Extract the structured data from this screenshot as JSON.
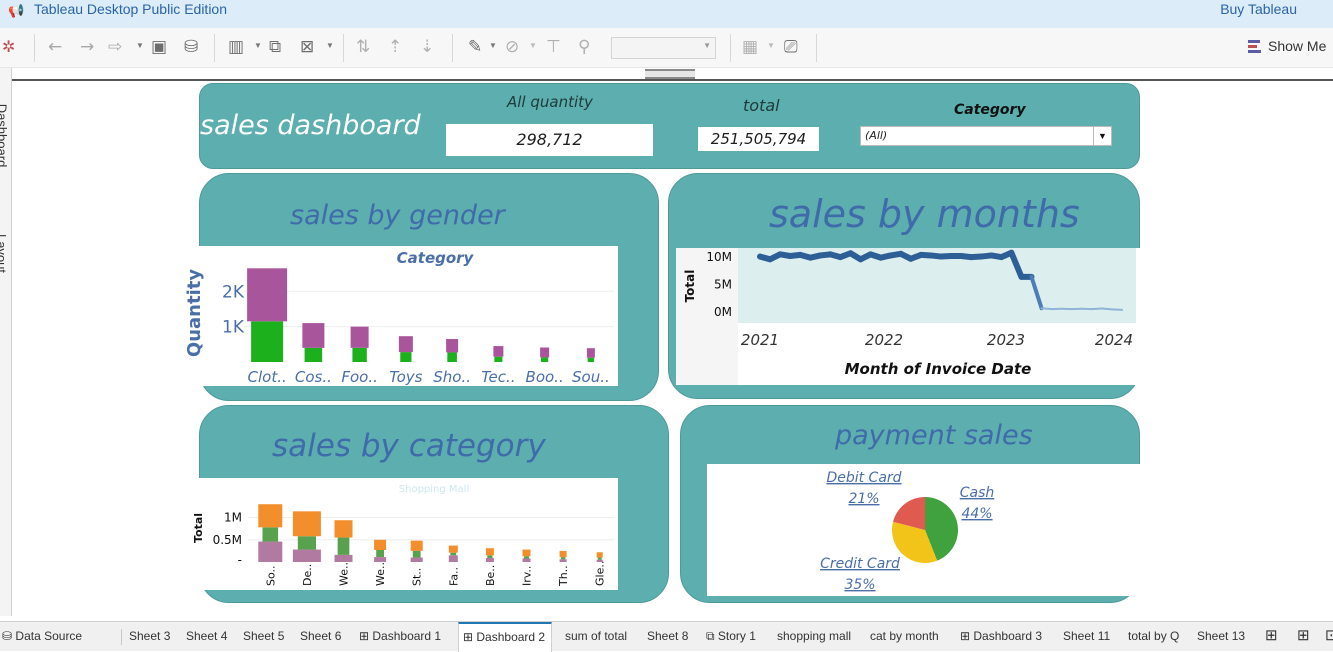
{
  "app": {
    "title": "Tableau Desktop Public Edition",
    "buy_label": "Buy Tableau",
    "show_me_label": "Show Me"
  },
  "left_rail": {
    "tabs": [
      "Dashboard",
      "Layout"
    ]
  },
  "dashboard": {
    "title": "sales dashboard",
    "kpis": {
      "quantity_label": "All quantity",
      "quantity_value": "298,712",
      "total_label": "total",
      "total_value": "251,505,794"
    },
    "filter": {
      "label": "Category",
      "value": "(All)"
    }
  },
  "gender_panel": {
    "title": "sales by gender",
    "chart_header": "Category",
    "chart_data": {
      "type": "bar",
      "stacked": true,
      "title": "Category",
      "ylabel": "Quantity",
      "yticks": [
        "2K",
        "1K"
      ],
      "ylim": [
        0,
        2800
      ],
      "categories": [
        "Clot..",
        "Cos..",
        "Foo..",
        "Toys",
        "Sho..",
        "Tec..",
        "Boo..",
        "Sou.."
      ],
      "series": [
        {
          "color": "#1cb01c",
          "values": [
            1150,
            400,
            400,
            280,
            270,
            150,
            130,
            120
          ]
        },
        {
          "color": "#a8559c",
          "values": [
            1500,
            700,
            600,
            450,
            380,
            300,
            280,
            270
          ]
        }
      ]
    }
  },
  "months_panel": {
    "title": "sales by months",
    "chart_data": {
      "type": "line",
      "ylabel": "Total",
      "xlabel": "Month of Invoice Date",
      "yticks": [
        "10M",
        "5M",
        "0M"
      ],
      "ylim": [
        0,
        11000000
      ],
      "xticks": [
        "2021",
        "2022",
        "2023",
        "2024"
      ],
      "x": [
        "2021-01",
        "2021-02",
        "2021-03",
        "2021-04",
        "2021-05",
        "2021-06",
        "2021-07",
        "2021-08",
        "2021-09",
        "2021-10",
        "2021-11",
        "2021-12",
        "2022-01",
        "2022-02",
        "2022-03",
        "2022-04",
        "2022-05",
        "2022-06",
        "2022-07",
        "2022-08",
        "2022-09",
        "2022-10",
        "2022-11",
        "2022-12",
        "2023-01",
        "2023-02",
        "2023-03",
        "2023-04",
        "2023-05",
        "2023-06",
        "2023-07",
        "2023-08",
        "2023-09",
        "2023-10",
        "2023-11",
        "2023-12",
        "2024-01"
      ],
      "y": [
        9900000,
        9400000,
        10300000,
        10000000,
        10200000,
        9700000,
        10100000,
        10300000,
        9800000,
        10500000,
        9400000,
        10300000,
        9700000,
        10100000,
        10400000,
        9500000,
        10200000,
        10100000,
        9900000,
        10000000,
        10000000,
        9800000,
        9900000,
        10100000,
        9800000,
        10600000,
        6200000,
        6200000,
        500000,
        350000,
        400000,
        350000,
        400000,
        350000,
        450000,
        300000,
        200000
      ]
    }
  },
  "category_panel": {
    "title": "sales by category",
    "watermark": "Shopping Mall",
    "chart_data": {
      "type": "bar",
      "stacked": true,
      "ylabel": "Total",
      "yticks": [
        "1M",
        "0.5M"
      ],
      "ylim": [
        0,
        1400000
      ],
      "categories": [
        "So..",
        "De..",
        "We..",
        "We..",
        "St..",
        "Fa..",
        "Be..",
        "Irv..",
        "Th..",
        "Gle.."
      ],
      "series": [
        {
          "color": "#b07aa1",
          "values": [
            460000,
            280000,
            160000,
            110000,
            100000,
            150000,
            90000,
            80000,
            60000,
            50000
          ]
        },
        {
          "color": "#59a14f",
          "values": [
            320000,
            300000,
            390000,
            160000,
            150000,
            60000,
            60000,
            50000,
            50000,
            50000
          ]
        },
        {
          "color": "#f28e2b",
          "values": [
            520000,
            560000,
            390000,
            230000,
            230000,
            160000,
            160000,
            150000,
            140000,
            120000
          ]
        }
      ]
    }
  },
  "payment_panel": {
    "title": "payment sales",
    "chart_data": {
      "type": "pie",
      "slices": [
        {
          "label": "Cash",
          "pct_label": "44%",
          "value": 44,
          "color": "#3fa23f"
        },
        {
          "label": "Credit Card",
          "pct_label": "35%",
          "value": 35,
          "color": "#f2c318"
        },
        {
          "label": "Debit Card",
          "pct_label": "21%",
          "value": 21,
          "color": "#e05a4f"
        }
      ]
    }
  },
  "sheet_tabs": {
    "data_source": "Data Source",
    "tabs": [
      "Sheet 3",
      "Sheet 4",
      "Sheet 5",
      "Sheet 6",
      "Dashboard 1",
      "Dashboard 2",
      "sum of total",
      "Sheet 8",
      "Story 1",
      "shopping mall",
      "cat by month",
      "Dashboard 3",
      "Sheet 11",
      "total by Q",
      "Sheet 13"
    ],
    "active": "Dashboard 2"
  },
  "icons": [
    "tableau-logo-icon",
    "undo-icon",
    "redo-icon",
    "replay-icon",
    "save-icon",
    "new-datasource-icon",
    "new-worksheet-icon",
    "duplicate-icon",
    "clear-sheet-icon",
    "swap-icon",
    "sort-asc-icon",
    "sort-desc-icon",
    "highlight-icon",
    "group-icon",
    "label-icon",
    "pin-icon",
    "show-cards-icon",
    "presentation-icon",
    "show-me-icon"
  ]
}
